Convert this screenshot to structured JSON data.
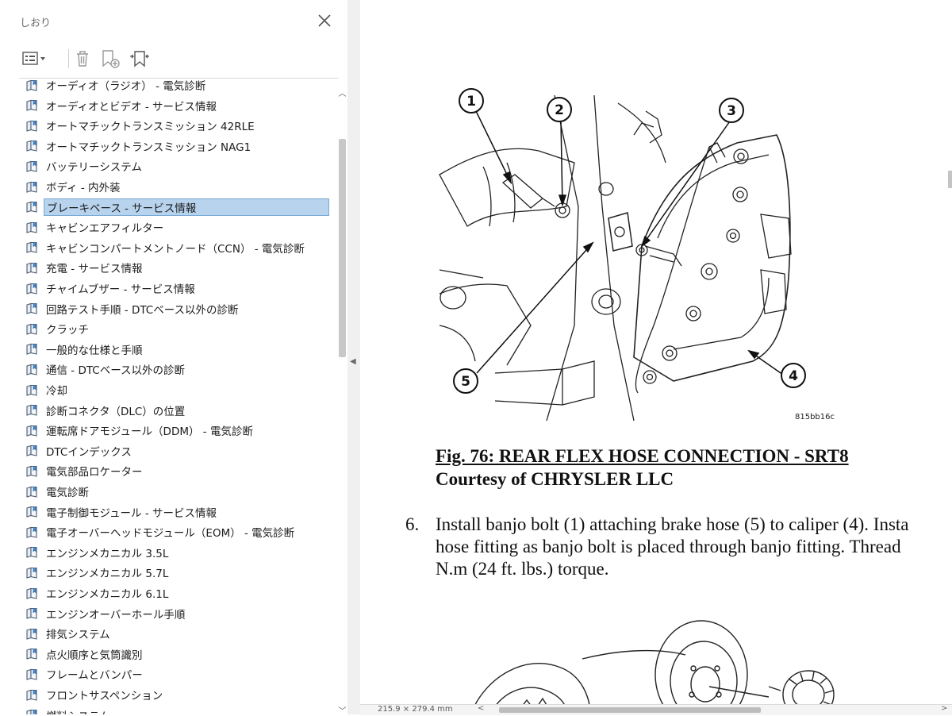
{
  "panel": {
    "title": "しおり",
    "close_icon": "close-icon",
    "toolbar": {
      "options_icon": "list-options-icon",
      "delete_icon": "trash-icon",
      "new_bookmark_icon": "new-bookmark-icon",
      "expand_icon": "expand-bookmark-icon"
    },
    "items": [
      {
        "label": "オーディオ（ラジオ） - 電気診断",
        "selected": false
      },
      {
        "label": "オーディオとビデオ - サービス情報",
        "selected": false
      },
      {
        "label": "オートマチックトランスミッション 42RLE",
        "selected": false
      },
      {
        "label": "オートマチックトランスミッション NAG1",
        "selected": false
      },
      {
        "label": "バッテリーシステム",
        "selected": false
      },
      {
        "label": "ボディ - 内外装",
        "selected": false
      },
      {
        "label": "ブレーキベース - サービス情報",
        "selected": true
      },
      {
        "label": "キャビンエアフィルター",
        "selected": false
      },
      {
        "label": "キャビンコンパートメントノード（CCN） - 電気診断",
        "selected": false
      },
      {
        "label": "充電 - サービス情報",
        "selected": false
      },
      {
        "label": "チャイムブザー - サービス情報",
        "selected": false
      },
      {
        "label": "回路テスト手順 - DTCベース以外の診断",
        "selected": false
      },
      {
        "label": "クラッチ",
        "selected": false
      },
      {
        "label": "一般的な仕様と手順",
        "selected": false
      },
      {
        "label": "通信 - DTCベース以外の診断",
        "selected": false
      },
      {
        "label": "冷却",
        "selected": false
      },
      {
        "label": "診断コネクタ（DLC）の位置",
        "selected": false
      },
      {
        "label": "運転席ドアモジュール（DDM） - 電気診断",
        "selected": false
      },
      {
        "label": "DTCインデックス",
        "selected": false
      },
      {
        "label": "電気部品ロケーター",
        "selected": false
      },
      {
        "label": "電気診断",
        "selected": false
      },
      {
        "label": "電子制御モジュール - サービス情報",
        "selected": false
      },
      {
        "label": "電子オーバーヘッドモジュール（EOM） - 電気診断",
        "selected": false
      },
      {
        "label": "エンジンメカニカル 3.5L",
        "selected": false
      },
      {
        "label": "エンジンメカニカル 5.7L",
        "selected": false
      },
      {
        "label": "エンジンメカニカル 6.1L",
        "selected": false
      },
      {
        "label": "エンジンオーバーホール手順",
        "selected": false
      },
      {
        "label": "排気システム",
        "selected": false
      },
      {
        "label": "点火順序と気筒識別",
        "selected": false
      },
      {
        "label": "フレームとバンパー",
        "selected": false
      },
      {
        "label": "フロントサスペンション",
        "selected": false
      },
      {
        "label": "燃料システム",
        "selected": false
      }
    ],
    "selected_color": "#b7d3ee"
  },
  "document": {
    "figure": {
      "callouts": [
        "1",
        "2",
        "3",
        "4",
        "5"
      ],
      "code": "815bb16c"
    },
    "caption": "Fig. 76: REAR FLEX HOSE CONNECTION - SRT8",
    "courtesy": "Courtesy of CHRYSLER LLC",
    "step": {
      "number": "6.",
      "lines": [
        "Install banjo bolt (1) attaching brake hose (5) to caliper (4). Insta",
        "hose fitting as banjo bolt is placed through banjo fitting. Thread",
        "N.m (24 ft. lbs.) torque."
      ]
    }
  },
  "status": {
    "page_size": "215.9 × 279.4 mm"
  }
}
